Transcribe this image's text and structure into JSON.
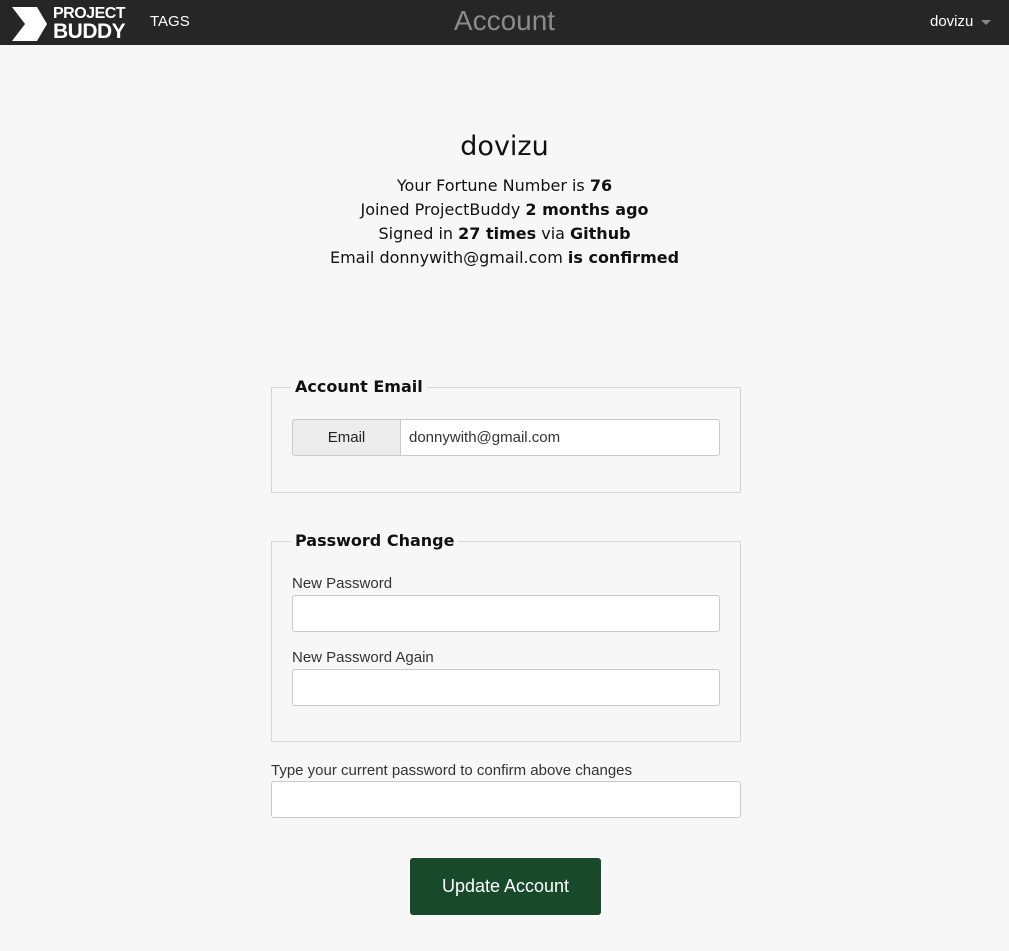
{
  "navbar": {
    "logo_line1": "PROJECT",
    "logo_line2": "BUDDY",
    "tags_label": "TAGS",
    "page_title": "Account",
    "username": "dovizu"
  },
  "profile": {
    "username": "dovizu",
    "fortune_prefix": "Your Fortune Number is ",
    "fortune_number": "76",
    "joined_prefix": "Joined ProjectBuddy ",
    "joined_value": "2 months ago",
    "signed_prefix": "Signed in ",
    "signed_count": "27 times",
    "signed_via": " via ",
    "signed_provider": "Github",
    "email_prefix": "Email ",
    "email_address": "donnywith@gmail.com",
    "email_status": "is confirmed"
  },
  "account_email": {
    "legend": "Account Email",
    "addon_label": "Email",
    "value": "donnywith@gmail.com"
  },
  "password_change": {
    "legend": "Password Change",
    "new_password_label": "New Password",
    "new_password_again_label": "New Password Again"
  },
  "confirm": {
    "label": "Type your current password to confirm above changes"
  },
  "update_button_label": "Update Account",
  "colors": {
    "navbar_bg": "#262626",
    "page_bg": "#f7f7f7",
    "button_bg": "#17492a"
  }
}
